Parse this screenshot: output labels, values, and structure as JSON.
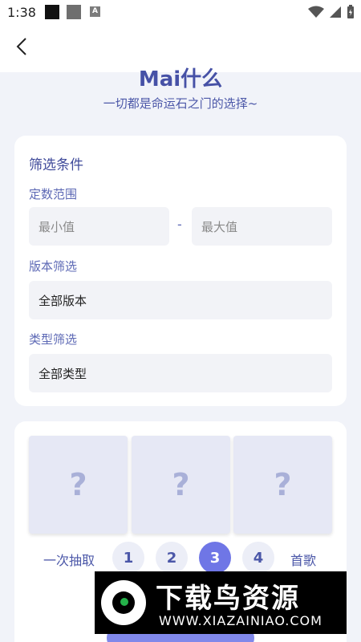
{
  "status_bar": {
    "time": "1:38",
    "notif_a": "A"
  },
  "header": {
    "title": "Mai什么",
    "subtitle": "一切都是命运石之门的选择~"
  },
  "filters": {
    "section_title": "筛选条件",
    "range_label": "定数范围",
    "min_placeholder": "最小值",
    "separator": "-",
    "max_placeholder": "最大值",
    "version_label": "版本筛选",
    "version_value": "全部版本",
    "type_label": "类型筛选",
    "type_value": "全部类型"
  },
  "draw": {
    "slots": [
      "?",
      "?",
      "?"
    ],
    "once_label": "一次抽取",
    "counts": [
      "1",
      "2",
      "3",
      "4"
    ],
    "selected_count": "3",
    "songs_label": "首歌"
  },
  "watermark": {
    "main": "下载鸟资源",
    "url": "WWW.XIAZAINIAO.COM"
  },
  "colors": {
    "accent": "#6f76e6",
    "title": "#4651a6",
    "background": "#f1f3f9"
  }
}
